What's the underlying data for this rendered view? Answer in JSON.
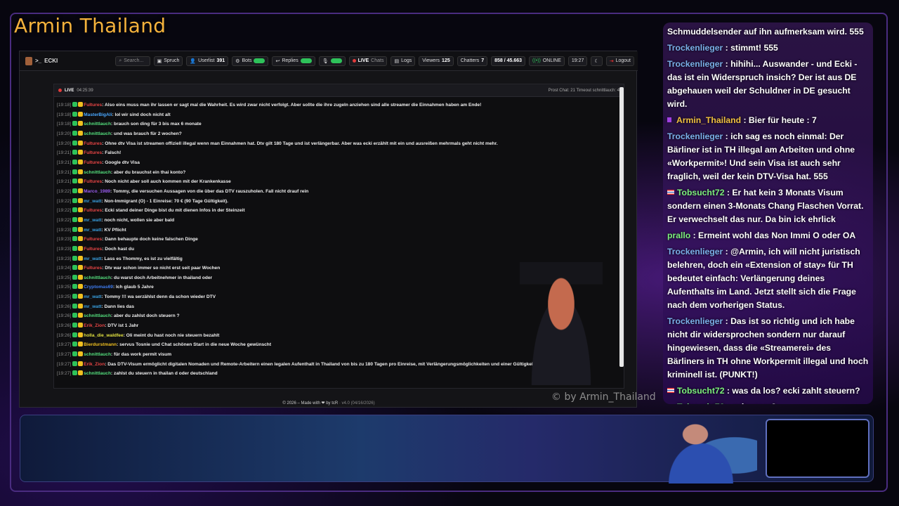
{
  "overlay_title": "Armin Thailand",
  "watermark": "© by Armin_Thailand",
  "topbar": {
    "brand": "ECKI",
    "search_placeholder": "Search...",
    "buttons": [
      {
        "icon": "speech-icon",
        "label": "Spruch"
      },
      {
        "icon": "users-icon",
        "label": "Userlist",
        "count": "391"
      },
      {
        "icon": "bot-icon",
        "label": "Bots",
        "toggle": "on"
      },
      {
        "icon": "reply-icon",
        "label": "Replies",
        "toggle": "on"
      },
      {
        "icon": "mic-icon",
        "label": "",
        "toggle": "on"
      },
      {
        "icon": "live-icon",
        "label": "LIVE",
        "sub": "Chats"
      },
      {
        "icon": "logs-icon",
        "label": "Logs"
      }
    ],
    "viewers_label": "Viewers",
    "viewers": "125",
    "chatters_label": "Chatters",
    "chatters": "7",
    "ratio": "858 / 45.663",
    "status": "ONLINE",
    "time": "19:27",
    "logout": "Logout"
  },
  "chat_header": {
    "live": "LIVE",
    "duration": "04:25:39",
    "right": "Prost Chat: 21  Timeout schnittlauch: 4"
  },
  "messages": [
    {
      "t": "[19:18]",
      "u": "Fultures",
      "c": "#e84545",
      "x": "Also eins muss man ihr lassen er sagt mal die Wahrheit. Es wird zwar nicht verfolgt. Aber sollte die ihre zugeln anziehen sind alle streamer die Einnahmen haben am Ende!"
    },
    {
      "t": "[19:18]",
      "u": "MasterBigAli",
      "c": "#4aa8ff",
      "x": "lol wir sind doch nicht alt"
    },
    {
      "t": "[19:18]",
      "u": "schnittlauch",
      "c": "#55e17e",
      "x": "brauch son ding für 3 bis max 6 monate"
    },
    {
      "t": "[19:20]",
      "u": "schnittlauch",
      "c": "#55e17e",
      "x": "und was brauch für 2 wochen?"
    },
    {
      "t": "[19:20]",
      "u": "Fultures",
      "c": "#e84545",
      "x": "Ohne dtv Visa ist streamen offiziell illegal wenn man Einnahmen hat. Dtv gilt 180 Tage und ist verlängerbar. Aber was ecki erzählt mit ein und ausreißen mehrmals geht nicht mehr."
    },
    {
      "t": "[19:21]",
      "u": "Fultures",
      "c": "#e84545",
      "x": "Falsch!"
    },
    {
      "t": "[19:21]",
      "u": "Fultures",
      "c": "#e84545",
      "x": "Google dtv Visa"
    },
    {
      "t": "[19:21]",
      "u": "schnittlauch",
      "c": "#55e17e",
      "x": "aber du brauchst ein thai konto?"
    },
    {
      "t": "[19:21]",
      "u": "Fultures",
      "c": "#e84545",
      "x": "Noch nicht aber soll auch kommen mit der Krankenkasse"
    },
    {
      "t": "[19:22]",
      "u": "Marco_1989",
      "c": "#9a5cf0",
      "x": "Tommy, die versuchen Aussagen von die über das DTV rauszuholen. Fall nicht drauf rein"
    },
    {
      "t": "[19:22]",
      "u": "mr_watt",
      "c": "#39a0e0",
      "x": "Non-Immigrant (O) - 1 Einreise: 70 € (90 Tage Gültigkeit)."
    },
    {
      "t": "[19:22]",
      "u": "Fultures",
      "c": "#e84545",
      "x": "Ecki stand deiner Dinge bist du mit dienen Infos in der Steinzeit"
    },
    {
      "t": "[19:22]",
      "u": "mr_watt",
      "c": "#39a0e0",
      "x": "noch nicht, wollen sie aber bald"
    },
    {
      "t": "[19:23]",
      "u": "mr_watt",
      "c": "#39a0e0",
      "x": "KV Pflicht"
    },
    {
      "t": "[19:23]",
      "u": "Fultures",
      "c": "#e84545",
      "x": "Dann behaupte doch keine falschen Dinge"
    },
    {
      "t": "[19:23]",
      "u": "Fultures",
      "c": "#e84545",
      "x": "Doch hast du"
    },
    {
      "t": "[19:23]",
      "u": "mr_watt",
      "c": "#39a0e0",
      "x": "Lass es Thommy, es ist zu vielfältig"
    },
    {
      "t": "[19:24]",
      "u": "Fultures",
      "c": "#e84545",
      "x": "Dtv war schon immer so nicht erst seit paar Wochen"
    },
    {
      "t": "[19:25]",
      "u": "schnittlauch",
      "c": "#55e17e",
      "x": "du warst doch Arbeitnehmer in thailand oder"
    },
    {
      "t": "[19:25]",
      "u": "Cryptomas69",
      "c": "#3f7cf0",
      "x": "Ich glaub 5 Jahre"
    },
    {
      "t": "[19:25]",
      "u": "mr_watt",
      "c": "#39a0e0",
      "x": "Tommy !!! wa serzählst denn da schon wieder DTV"
    },
    {
      "t": "[19:26]",
      "u": "mr_watt",
      "c": "#39a0e0",
      "x": "Dann lies das"
    },
    {
      "t": "[19:26]",
      "u": "schnittlauch",
      "c": "#55e17e",
      "x": "aber du zahlst doch steuern ?"
    },
    {
      "t": "[19:26]",
      "u": "Erik_Zion",
      "c": "#e84545",
      "x": "DTV ist 1 Jahr"
    },
    {
      "t": "[19:26]",
      "u": "holla_die_waldfee",
      "c": "#e0e040",
      "x": "Oli meint du hast noch nie steuern bezahlt"
    },
    {
      "t": "[19:27]",
      "u": "Bierdurstmann",
      "c": "#f0c020",
      "x": "servus Tosnie und Chat schönen Start in die neue Woche gewünscht"
    },
    {
      "t": "[19:27]",
      "u": "schnittlauch",
      "c": "#55e17e",
      "x": "für das work permit visum"
    },
    {
      "t": "[19:27]",
      "u": "Erik_Zion",
      "c": "#e84545",
      "x": "Das DTV-Visum ermöglicht digitalen Nomaden und Remote-Arbeitern einen legalen Aufenthalt in Thailand von bis zu 180 Tagen pro Einreise, mit Verlängerungsmöglichkeiten und einer Gültigkeit von fünf Jahren.",
      "wrap": true
    },
    {
      "t": "[19:27]",
      "u": "schnittlauch",
      "c": "#55e17e",
      "x": "zahlst du steuern in thailan d oder deutschland"
    }
  ],
  "footer": {
    "text": "© 2026 – Made with ❤ by tcR",
    "version": "· v4.0 (04/16/2026)"
  },
  "stream_chat": [
    {
      "u": "",
      "c": "#fff",
      "x": "Schmuddelsender auf ihn aufmerksam wird. 555"
    },
    {
      "u": "Trockenlieger",
      "c": "#7ab0e8",
      "x": ": stimmt! 555"
    },
    {
      "u": "Trockenlieger",
      "c": "#7ab0e8",
      "x": ": hihihi... Auswander - und Ecki - das ist ein Widerspruch insich? Der ist aus DE abgehauen weil der Schuldner in DE gesucht wird."
    },
    {
      "u": "Armin_Thailand",
      "c": "#f0c040",
      "x": ": Bier für heute : 7",
      "icon": "badge"
    },
    {
      "u": "Trockenlieger",
      "c": "#7ab0e8",
      "x": ": ich sag es noch einmal: Der Bärliner ist in TH illegal am Arbeiten und ohne «Workpermit»! Und sein Visa ist auch sehr fraglich, weil der kein DTV-Visa hat. 555"
    },
    {
      "u": "Tobsucht72",
      "c": "#7cf07c",
      "x": ": Er hat kein 3 Monats Visum sondern einen 3-Monats Chang Flaschen Vorrat. Er verwechselt das nur. Da bin ick ehrlick",
      "icon": "flag"
    },
    {
      "u": "prallo",
      "c": "#7cf07c",
      "x": ": Ermeint wohl das Non Immi O oder OA"
    },
    {
      "u": "Trockenlieger",
      "c": "#7ab0e8",
      "x": ": @Armin, ich will nicht juristisch belehren, doch ein «Extension of stay» für TH bedeutet einfach: Verlängerung deines Aufenthalts im Land. Jetzt stellt sich die Frage nach dem vorherigen Status."
    },
    {
      "u": "Trockenlieger",
      "c": "#7ab0e8",
      "x": ": Das ist so richtig und ich habe nicht dir widersprochen sondern nur darauf hingewiesen, dass die «Streamerei» des Bärliners in TH ohne Workpermit illegal und hoch kriminell ist. (PUNKT!)"
    },
    {
      "u": "Tobsucht72",
      "c": "#7cf07c",
      "x": ": was da los? ecki zahlt steuern?",
      "icon": "flag"
    },
    {
      "u": "Tobsucht72",
      "c": "#7cf07c",
      "x": ": seit wann?",
      "icon": "flag"
    }
  ]
}
